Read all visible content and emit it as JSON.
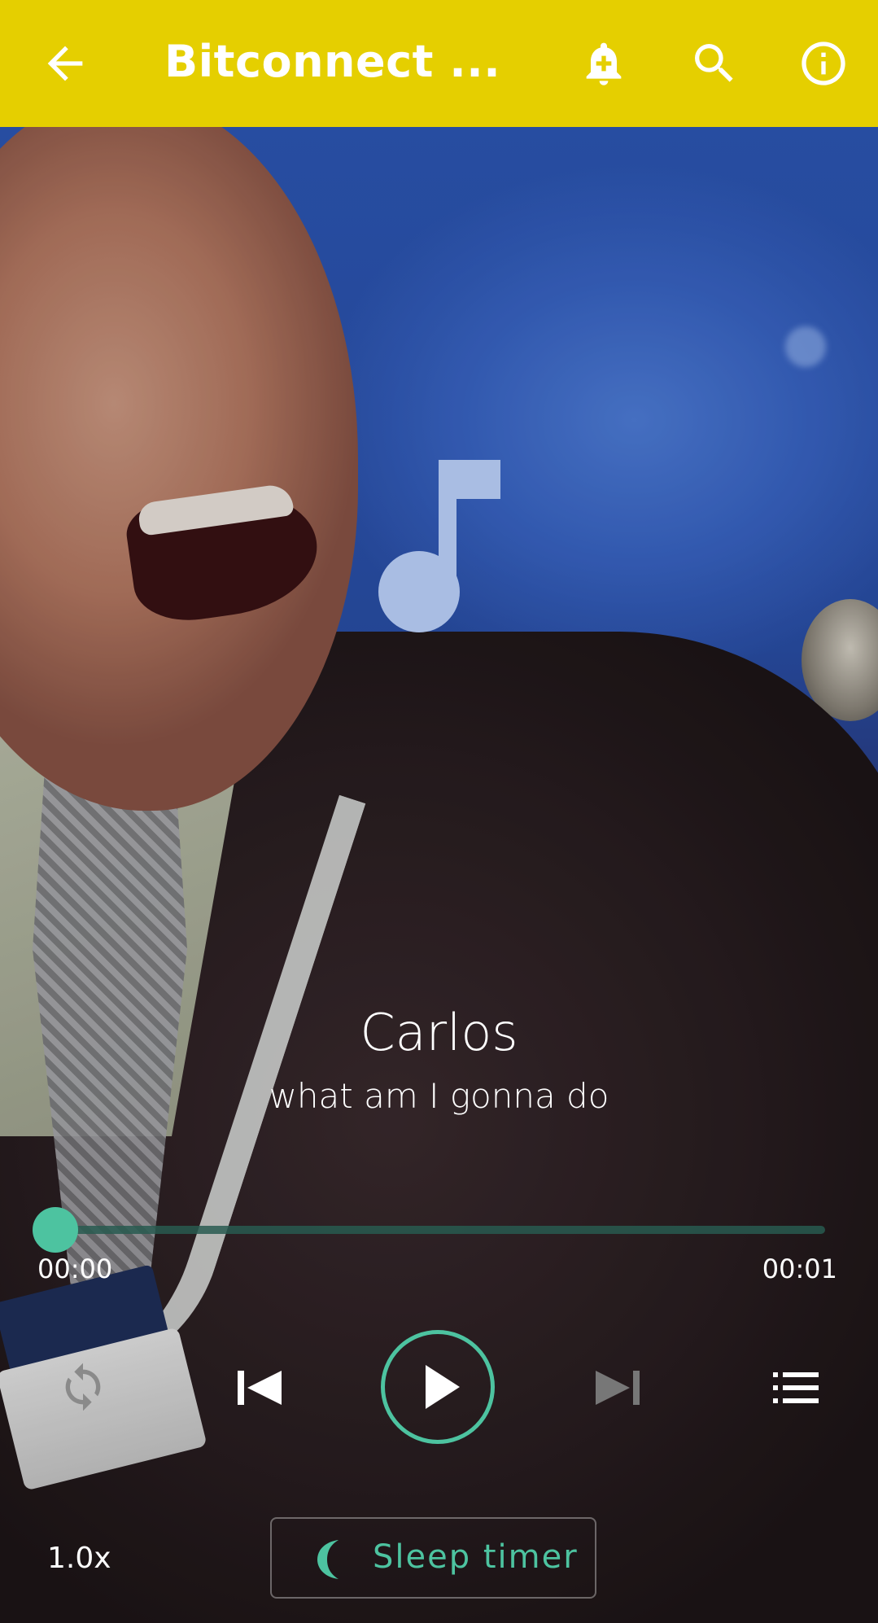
{
  "appbar": {
    "title": "Bitconnect ...",
    "background": "#e5cf00",
    "icons": [
      "back-arrow-icon",
      "add-alarm-icon",
      "search-icon",
      "info-icon"
    ]
  },
  "track": {
    "title": "Carlos",
    "subtitle": "what am I gonna do"
  },
  "player": {
    "elapsed": "00:00",
    "duration": "00:01",
    "progress": 0.0,
    "speed": "1.0x",
    "sleep_timer_label": "Sleep timer",
    "accent": "#4dc3a0",
    "controls": [
      "repeat-icon",
      "previous-icon",
      "play-icon",
      "next-icon",
      "queue-icon"
    ]
  }
}
